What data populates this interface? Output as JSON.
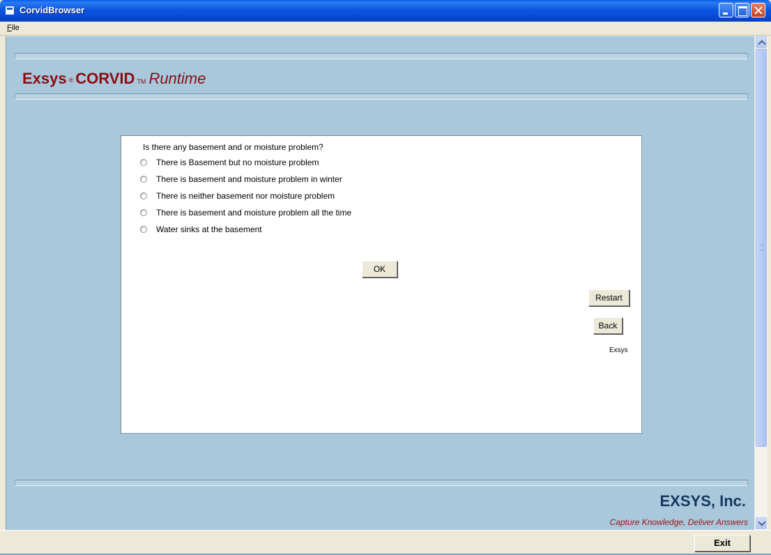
{
  "window": {
    "title": "CorvidBrowser"
  },
  "menu": {
    "items": [
      "File"
    ]
  },
  "header": {
    "brand_main": "Exsys",
    "brand_registered": "®",
    "brand_product": "CORVID",
    "brand_trademark": "TM",
    "brand_runtime": "Runtime"
  },
  "question": {
    "text": "Is there any basement and or moisture problem?",
    "options": [
      {
        "label": "There is Basement but no moisture problem",
        "selected": false
      },
      {
        "label": "There is basement and moisture problem in winter",
        "selected": false
      },
      {
        "label": "There is neither basement nor moisture problem",
        "selected": false
      },
      {
        "label": "There is basement and moisture problem all the time",
        "selected": false
      },
      {
        "label": "Water sinks at the basement",
        "selected": false
      }
    ],
    "ok_label": "OK",
    "restart_label": "Restart",
    "back_label": "Back",
    "footer_text": "Exsys"
  },
  "footer": {
    "company": "EXSYS, Inc.",
    "tagline": "Capture Knowledge, Deliver Answers"
  },
  "statusbar": {
    "exit_label": "Exit"
  },
  "colors": {
    "content_bg": "#a9c8dc",
    "brand_red": "#8b0d12",
    "company_blue": "#17375e",
    "titlebar_blue": "#0b56e0"
  }
}
